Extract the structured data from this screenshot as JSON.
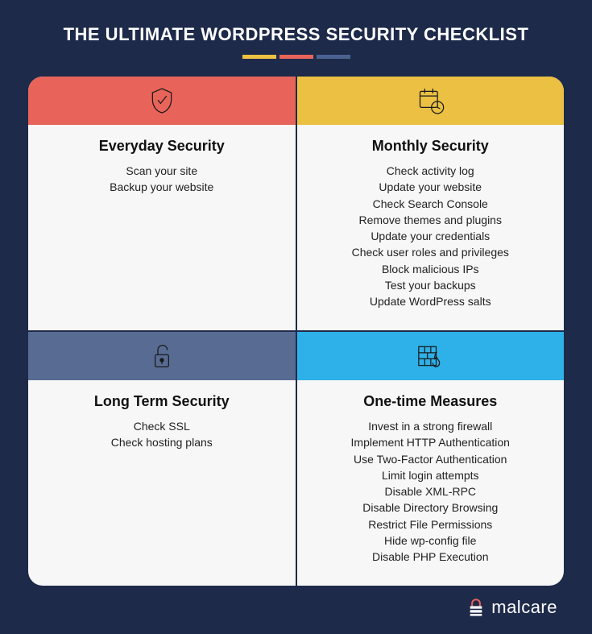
{
  "title": "THE ULTIMATE WORDPRESS SECURITY CHECKLIST",
  "cards": [
    {
      "title": "Everyday Security",
      "items": [
        "Scan your site",
        "Backup your website"
      ]
    },
    {
      "title": "Monthly Security",
      "items": [
        "Check activity log",
        "Update your website",
        "Check Search Console",
        "Remove themes and plugins",
        "Update your credentials",
        "Check user roles and privileges",
        "Block malicious IPs",
        "Test your backups",
        "Update WordPress salts"
      ]
    },
    {
      "title": "Long Term Security",
      "items": [
        "Check SSL",
        "Check hosting plans"
      ]
    },
    {
      "title": "One-time Measures",
      "items": [
        "Invest in a strong firewall",
        "Implement HTTP Authentication",
        "Use Two-Factor Authentication",
        "Limit login attempts",
        "Disable XML-RPC",
        "Disable Directory Browsing",
        "Restrict File Permissions",
        "Hide wp-config file",
        "Disable PHP Execution"
      ]
    }
  ],
  "brand": "malcare"
}
